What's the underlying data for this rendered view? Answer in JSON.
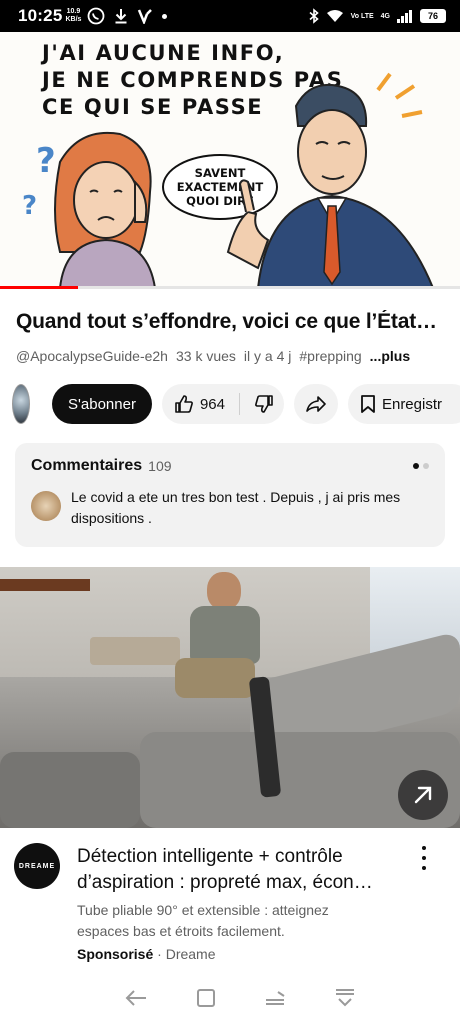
{
  "status_bar": {
    "time": "10:25",
    "net_speed_value": "10.9",
    "net_speed_unit": "KB/s",
    "battery": "76",
    "signal_label": "4G",
    "volte_label": "Vo LTE"
  },
  "video": {
    "thumbnail": {
      "comic_lines": [
        "J'AI AUCUNE INFO,",
        "JE NE COMPRENDS PAS",
        "CE QUI SE PASSE"
      ],
      "speech_lines": [
        "SAVENT",
        "EXACTEMENT",
        "QUOI DIRE"
      ]
    },
    "progress_fraction": 0.17,
    "title": "Quand tout s’effondre, voici ce que l’État…",
    "channel_handle": "@ApocalypseGuide-e2h",
    "views": "33 k vues",
    "age": "il y a 4 j",
    "hashtag": "#prepping",
    "more_label": "...plus"
  },
  "actions": {
    "subscribe_label": "S'abonner",
    "like_count": "964",
    "save_label": "Enregistr"
  },
  "comments": {
    "title": "Commentaires",
    "count": "109",
    "top_comment": "Le covid a ete un tres bon test . Depuis , j ai pris mes dispositions ."
  },
  "ad": {
    "logo_text": "DREAME",
    "title_line1": "Détection intelligente + contrôle",
    "title_line2": "d’aspiration : propreté max, écon…",
    "description": "Tube pliable 90° et extensible : atteignez espaces bas et étroits facilement.",
    "sponsored_label": "Sponsorisé",
    "advertiser": "Dreame",
    "separator": "·"
  },
  "colors": {
    "accent_red": "#ff0000",
    "text_primary": "#0f0f0f",
    "text_secondary": "#606060",
    "pill_bg": "#f2f2f2"
  },
  "icons": [
    "bluetooth-icon",
    "wifi-icon",
    "signal-icon",
    "whatsapp-icon",
    "download-icon",
    "v-app-icon",
    "like-icon",
    "dislike-icon",
    "share-icon",
    "save-icon",
    "open-link-icon",
    "back-icon",
    "home-icon",
    "recents-icon",
    "menu-down-icon"
  ]
}
